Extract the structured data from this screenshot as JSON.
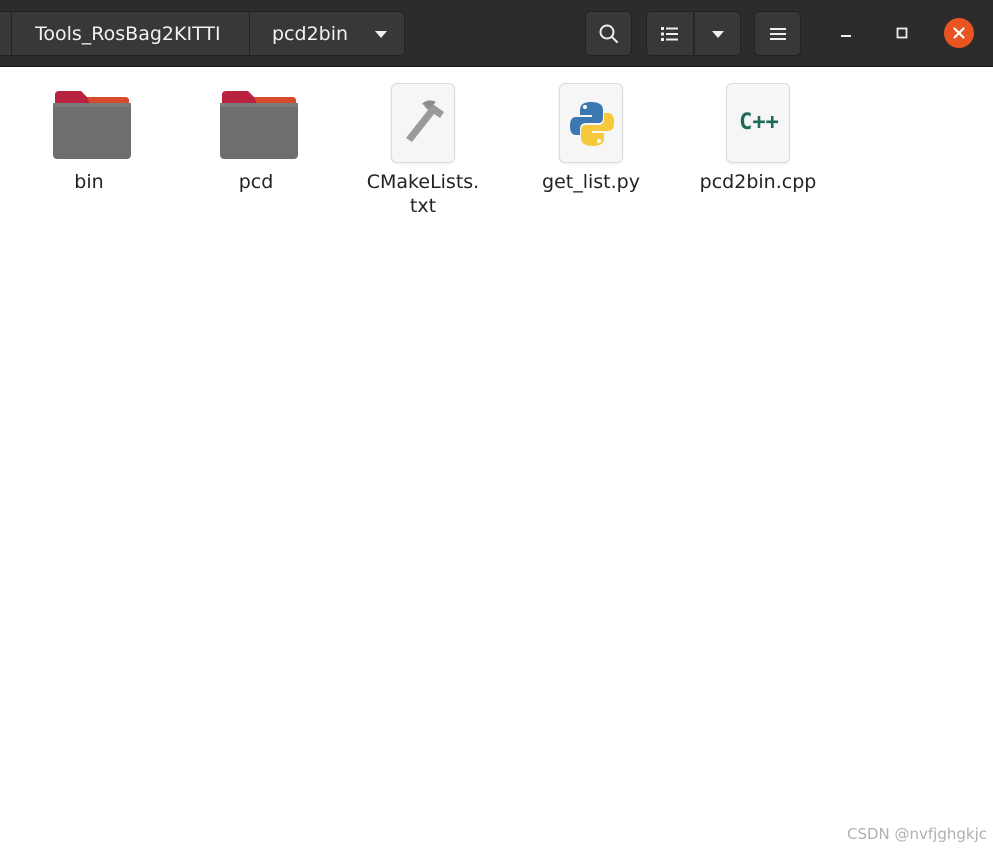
{
  "breadcrumbs": [
    {
      "label": "Tools_RosBag2KITTI"
    },
    {
      "label": "pcd2bin"
    }
  ],
  "files": [
    {
      "name": "bin",
      "kind": "folder"
    },
    {
      "name": "pcd",
      "kind": "folder"
    },
    {
      "name": "CMakeLists.\ntxt",
      "kind": "cmake"
    },
    {
      "name": "get_list.py",
      "kind": "python"
    },
    {
      "name": "pcd2bin.cpp",
      "kind": "cpp",
      "icon_text": "C++"
    }
  ],
  "colors": {
    "titlebar": "#2c2c2c",
    "close_button": "#e95420",
    "folder_tab": "#c0294a",
    "folder_body": "#6e6e6e",
    "cpp_text": "#1c6b58"
  },
  "watermark": "CSDN @nvfjghgkjc"
}
